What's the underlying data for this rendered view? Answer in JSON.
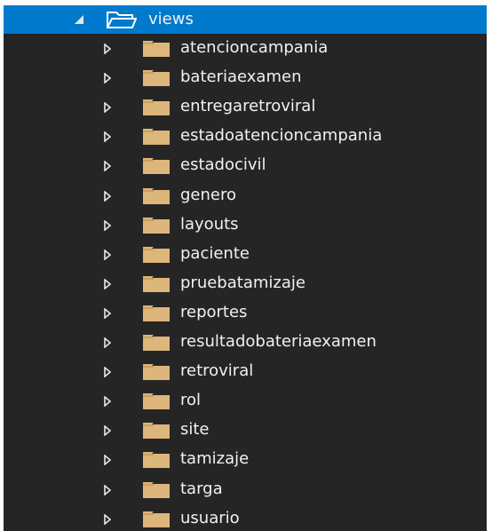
{
  "explorer": {
    "root": {
      "label": "views",
      "expanded": true
    },
    "items": [
      {
        "label": "atencioncampania"
      },
      {
        "label": "bateriaexamen"
      },
      {
        "label": "entregaretroviral"
      },
      {
        "label": "estadoatencioncampania"
      },
      {
        "label": "estadocivil"
      },
      {
        "label": "genero"
      },
      {
        "label": "layouts"
      },
      {
        "label": "paciente"
      },
      {
        "label": "pruebatamizaje"
      },
      {
        "label": "reportes"
      },
      {
        "label": "resultadobateriaexamen"
      },
      {
        "label": "retroviral"
      },
      {
        "label": "rol"
      },
      {
        "label": "site"
      },
      {
        "label": "tamizaje"
      },
      {
        "label": "targa"
      },
      {
        "label": "usuario"
      }
    ]
  },
  "colors": {
    "panel_bg": "#252526",
    "selection": "#007acc",
    "folder": "#dcb67a",
    "text": "#f1f1f1"
  }
}
